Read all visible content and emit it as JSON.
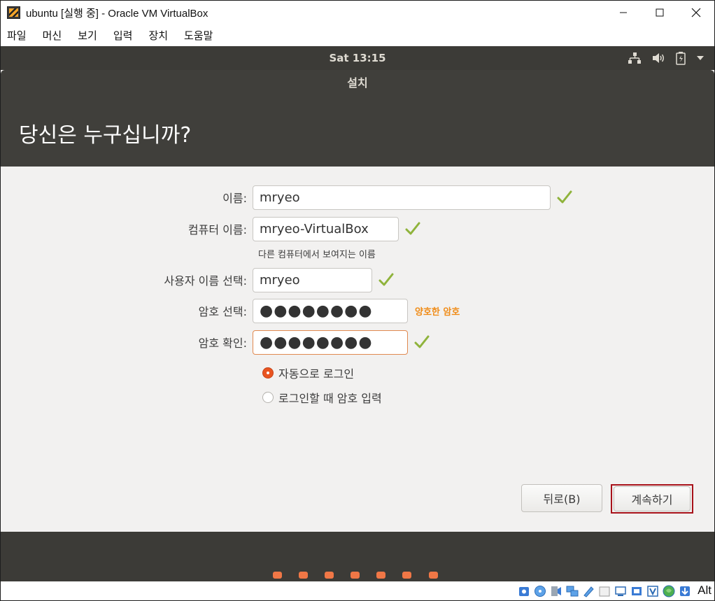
{
  "window": {
    "title": "ubuntu [실행 중] - Oracle VM VirtualBox",
    "minimize_label": "—",
    "maximize_label": "☐",
    "close_label": "✕"
  },
  "menubar": {
    "items": [
      "파일",
      "머신",
      "보기",
      "입력",
      "장치",
      "도움말"
    ]
  },
  "top_panel": {
    "clock": "Sat 13:15",
    "icons": [
      "network-icon",
      "volume-icon",
      "battery-icon",
      "chevron-down-icon"
    ]
  },
  "installer": {
    "title": "설치",
    "heading": "당신은 누구십니까?",
    "fields": {
      "name": {
        "label": "이름:",
        "value": "mryeo"
      },
      "computer_name": {
        "label": "컴퓨터 이름:",
        "value": "mryeo-VirtualBox",
        "hint": "다른 컴퓨터에서 보여지는 이름"
      },
      "username": {
        "label": "사용자 이름 선택:",
        "value": "mryeo"
      },
      "password": {
        "label": "암호 선택:",
        "value": "●●●●●●●●",
        "strength": "양호한 암호"
      },
      "confirm_password": {
        "label": "암호 확인:",
        "value": "●●●●●●●●"
      }
    },
    "login_options": {
      "auto_login": {
        "label": "자동으로 로그인",
        "selected": true
      },
      "require_password": {
        "label": "로그인할 때 암호 입력",
        "selected": false
      }
    },
    "buttons": {
      "back": "뒤로(B)",
      "continue": "계속하기"
    },
    "progress": {
      "total_steps": 7
    }
  },
  "statusbar": {
    "icons": [
      "hard-disk-icon",
      "optical-drive-icon",
      "audio-icon",
      "network-icon",
      "usb-icon",
      "shared-folders-icon",
      "display-icon",
      "video-capture-icon",
      "virtualization-icon",
      "mouse-integration-icon",
      "keyboard-icon"
    ],
    "host_key": "Alt"
  },
  "colors": {
    "panel_dark": "#3c3b37",
    "accent_orange": "#e95420",
    "strength_orange": "#f08c18",
    "check_green": "#8fb33b",
    "highlight_red": "#a8121a"
  }
}
